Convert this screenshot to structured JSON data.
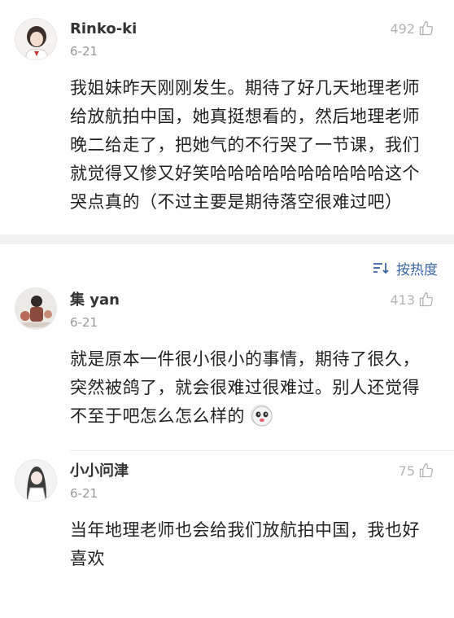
{
  "comments": [
    {
      "username": "Rinko-ki",
      "date": "6-21",
      "likes": "492",
      "text": "我姐妹昨天刚刚发生。期待了好几天地理老师给放航拍中国，她真挺想看的，然后地理老师晚二给走了，把她气的不行哭了一节课，我们就觉得又惨又好笑哈哈哈哈哈哈哈哈哈哈这个哭点真的（不过主要是期待落空很难过吧）"
    },
    {
      "username": "集 yan",
      "date": "6-21",
      "likes": "413",
      "text": "就是原本一件很小很小的事情，期待了很久，突然被鸽了，就会很难过很难过。别人还觉得不至于吧怎么怎么样的"
    },
    {
      "username": "小小问津",
      "date": "6-21",
      "likes": "75",
      "text": "当年地理老师也会给我们放航拍中国，我也好喜欢"
    }
  ],
  "sort": {
    "label": "按热度",
    "icon": "sort-icon"
  },
  "colors": {
    "accent": "#3a66a8",
    "meta": "#9a9a9a",
    "band": "#f2f2f2"
  }
}
